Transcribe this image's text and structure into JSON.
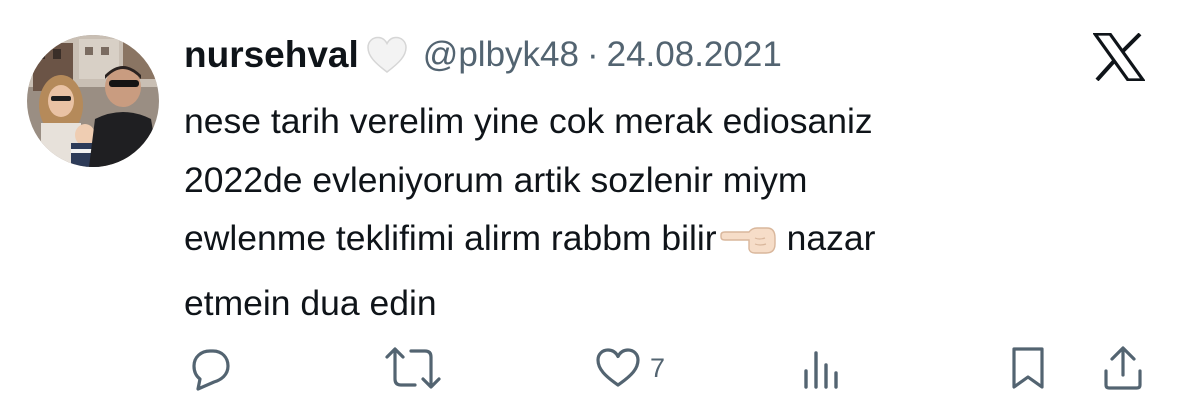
{
  "author": {
    "display_name": "nursehval",
    "handle": "@plbyk48",
    "separator": "·",
    "date": "24.08.2021"
  },
  "tweet": {
    "lines": [
      "nese tarih verelim yine cok merak ediosaniz",
      "2022de evleniyorum artik sozlenir miym",
      "ewlenme teklifimi alirm rabbm bilir",
      "etmein dua edin"
    ],
    "line3_after_emoji": "nazar",
    "emoji": "backhand-index-pointing-left"
  },
  "actions": {
    "reply_icon": "reply-icon",
    "retweet_icon": "retweet-icon",
    "like_icon": "heart-icon",
    "like_count": "7",
    "views_icon": "views-icon",
    "bookmark_icon": "bookmark-icon",
    "share_icon": "share-icon"
  },
  "colors": {
    "text": "#0f1419",
    "secondary": "#536471",
    "background": "#ffffff"
  }
}
